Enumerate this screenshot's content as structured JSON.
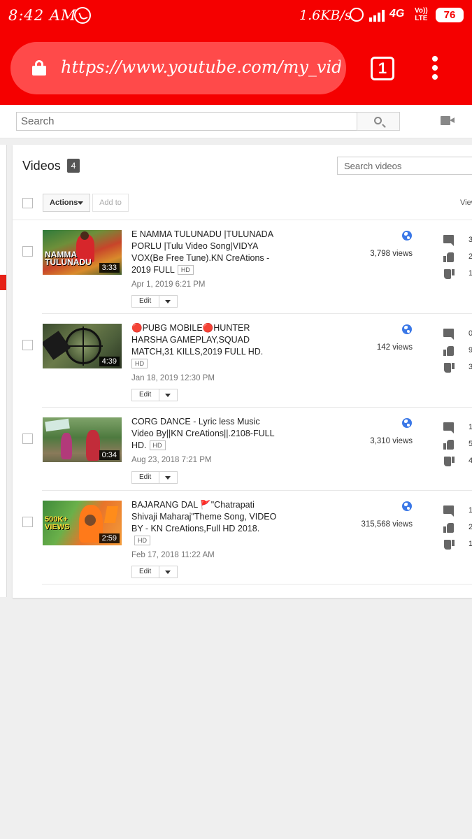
{
  "status_bar": {
    "time": "8:42 AM",
    "speed": "1.6KB/s",
    "network": "4G",
    "volte_top": "Vo))",
    "volte_bottom": "LTE",
    "battery": "76"
  },
  "browser": {
    "url": "https://www.youtube.com/my_videos?o",
    "tab_count": "1"
  },
  "yt_header": {
    "search_placeholder": "Search"
  },
  "videos_page": {
    "title": "Videos",
    "count": "4",
    "search_placeholder": "Search videos",
    "actions_label": "Actions",
    "addto_label": "Add to",
    "views_column": "Views"
  },
  "videos": [
    {
      "title": "E NAMMA TULUNADU |TULUNADA PORLU |Tulu Video Song|VIDYA VOX(Be Free Tune).KN CreAtions - 2019 FULL",
      "hd": "HD",
      "date": "Apr 1, 2019 6:21 PM",
      "duration": "3:33",
      "thumb_caption": "NAMMA TULUNADU",
      "edit_label": "Edit",
      "views": "3,798 views",
      "comments": "3",
      "likes": "2",
      "dislikes": "1"
    },
    {
      "title": "🔴PUBG MOBILE🔴HUNTER HARSHA GAMEPLAY,SQUAD MATCH,31 KILLS,2019 FULL HD.",
      "hd": "HD",
      "date": "Jan 18, 2019 12:30 PM",
      "duration": "4:39",
      "thumb_caption": "",
      "edit_label": "Edit",
      "views": "142 views",
      "comments": "0",
      "likes": "9",
      "dislikes": "3"
    },
    {
      "title": "CORG DANCE - Lyric less Music Video By||KN CreAtions||.2108-FULL HD.",
      "hd": "HD",
      "date": "Aug 23, 2018 7:21 PM",
      "duration": "0:34",
      "thumb_caption": "",
      "edit_label": "Edit",
      "views": "3,310 views",
      "comments": "1",
      "likes": "5",
      "dislikes": "4"
    },
    {
      "title": "BAJARANG DAL 🚩\"Chatrapati Shivaji Maharaj\"Theme Song, VIDEO BY - KN CreAtions,Full HD 2018.",
      "hd": "HD",
      "date": "Feb 17, 2018 11:22 AM",
      "duration": "2:59",
      "thumb_caption": "500K+ VIEWS",
      "edit_label": "Edit",
      "views": "315,568 views",
      "comments": "1",
      "likes": "2",
      "dislikes": "1"
    }
  ],
  "colors": {
    "chrome_red": "#f50000",
    "url_pill": "#ff4a4a",
    "globe_blue": "#3b78e7"
  }
}
